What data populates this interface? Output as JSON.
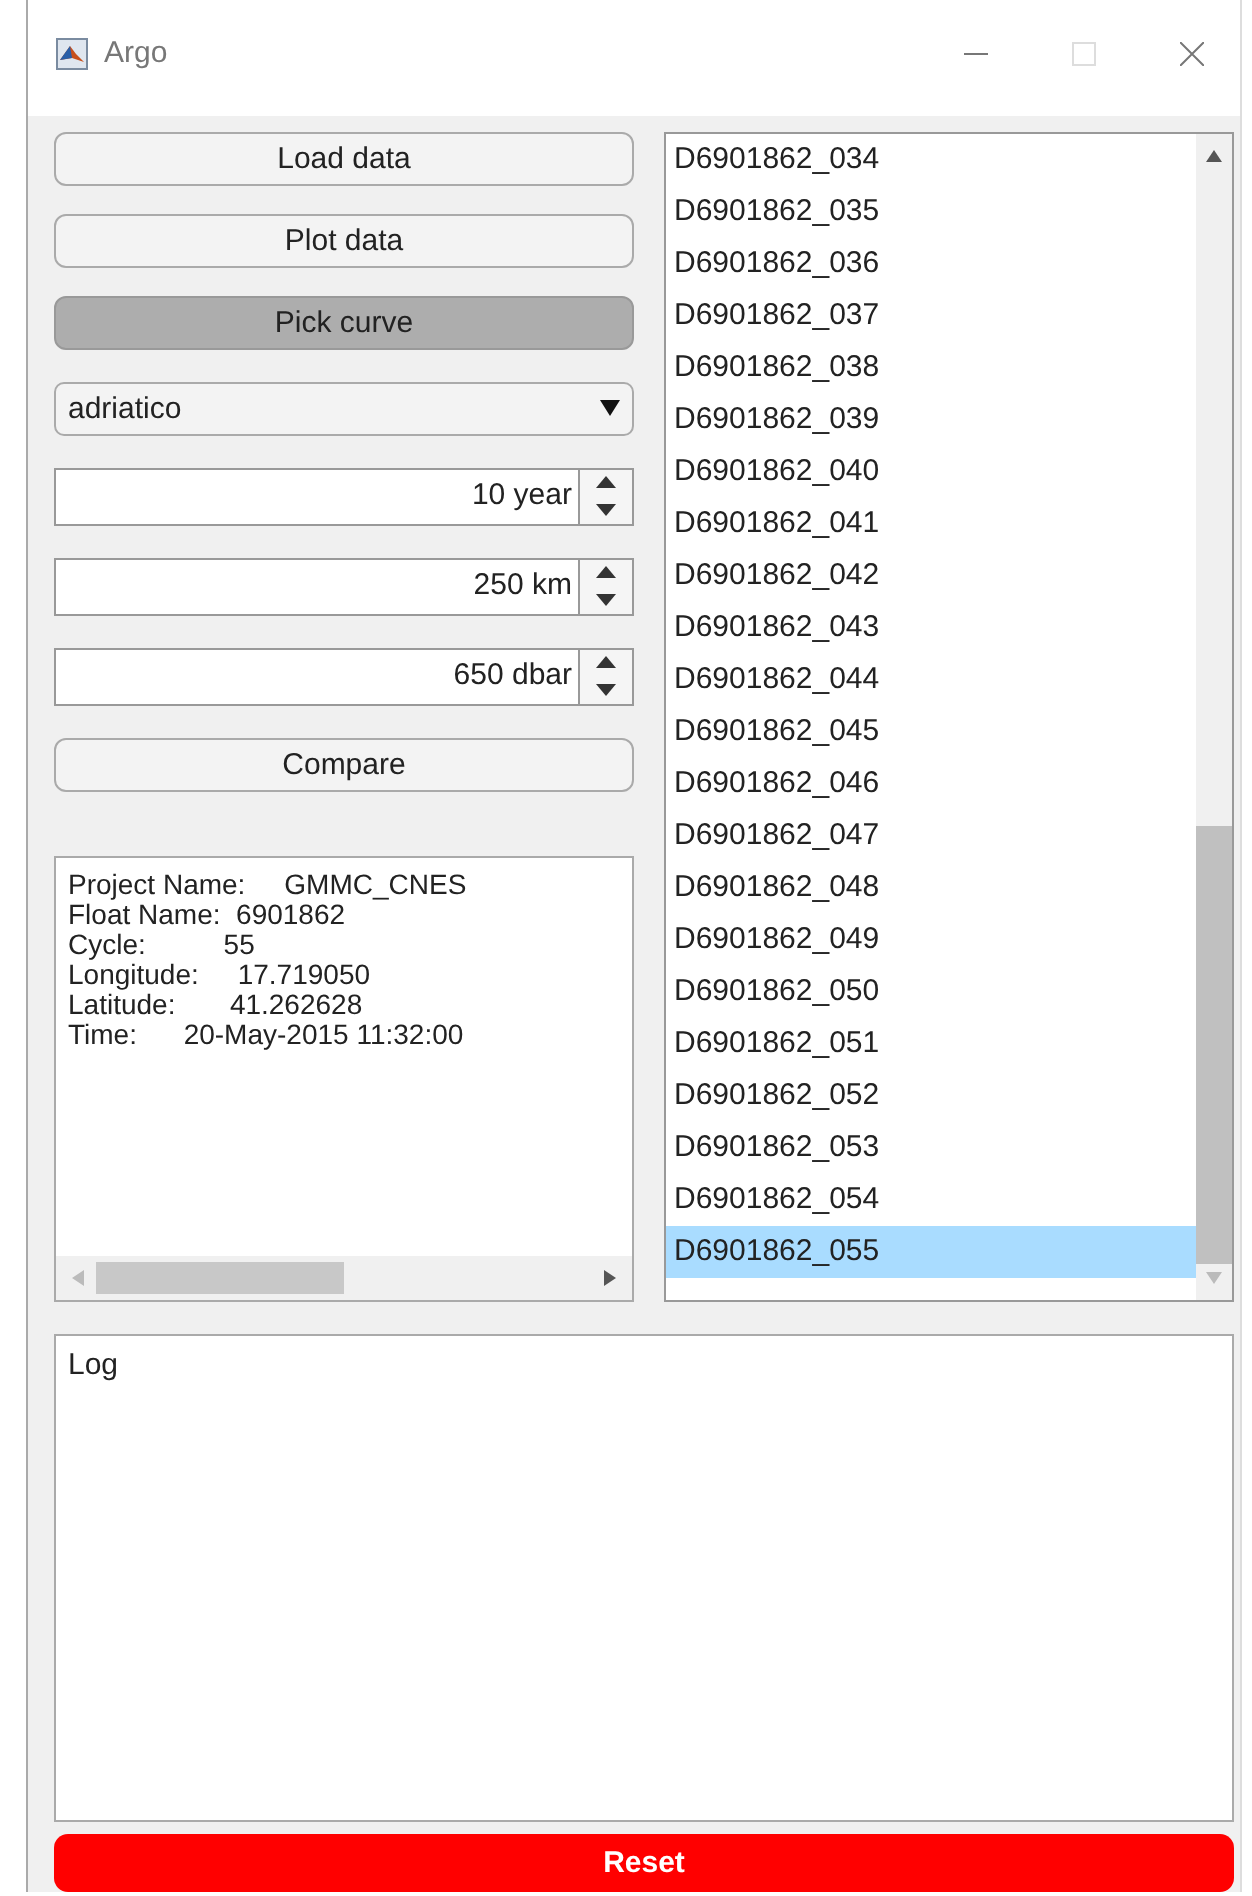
{
  "window": {
    "title": "Argo"
  },
  "controls": [
    {
      "kind": "button",
      "label": "Load data",
      "pressed": false
    },
    {
      "kind": "button",
      "label": "Plot data",
      "pressed": false
    },
    {
      "kind": "button",
      "label": "Pick curve",
      "pressed": true
    },
    {
      "kind": "dropdown",
      "value": "adriatico"
    },
    {
      "kind": "spinner",
      "value": "10 year"
    },
    {
      "kind": "spinner",
      "value": "250 km"
    },
    {
      "kind": "spinner",
      "value": "650 dbar"
    },
    {
      "kind": "button",
      "label": "Compare",
      "pressed": false
    }
  ],
  "info_lines": [
    "Project Name:     GMMC_CNES",
    "Float Name:  6901862",
    "Cycle:          55",
    "Longitude:     17.719050",
    "Latitude:       41.262628",
    "Time:      20-May-2015 11:32:00"
  ],
  "files": [
    {
      "name": "D6901862_034",
      "selected": false
    },
    {
      "name": "D6901862_035",
      "selected": false
    },
    {
      "name": "D6901862_036",
      "selected": false
    },
    {
      "name": "D6901862_037",
      "selected": false
    },
    {
      "name": "D6901862_038",
      "selected": false
    },
    {
      "name": "D6901862_039",
      "selected": false
    },
    {
      "name": "D6901862_040",
      "selected": false
    },
    {
      "name": "D6901862_041",
      "selected": false
    },
    {
      "name": "D6901862_042",
      "selected": false
    },
    {
      "name": "D6901862_043",
      "selected": false
    },
    {
      "name": "D6901862_044",
      "selected": false
    },
    {
      "name": "D6901862_045",
      "selected": false
    },
    {
      "name": "D6901862_046",
      "selected": false
    },
    {
      "name": "D6901862_047",
      "selected": false
    },
    {
      "name": "D6901862_048",
      "selected": false
    },
    {
      "name": "D6901862_049",
      "selected": false
    },
    {
      "name": "D6901862_050",
      "selected": false
    },
    {
      "name": "D6901862_051",
      "selected": false
    },
    {
      "name": "D6901862_052",
      "selected": false
    },
    {
      "name": "D6901862_053",
      "selected": false
    },
    {
      "name": "D6901862_054",
      "selected": false
    },
    {
      "name": "D6901862_055",
      "selected": true
    }
  ],
  "log": {
    "text": "Log"
  },
  "reset_button": {
    "label": "Reset"
  }
}
